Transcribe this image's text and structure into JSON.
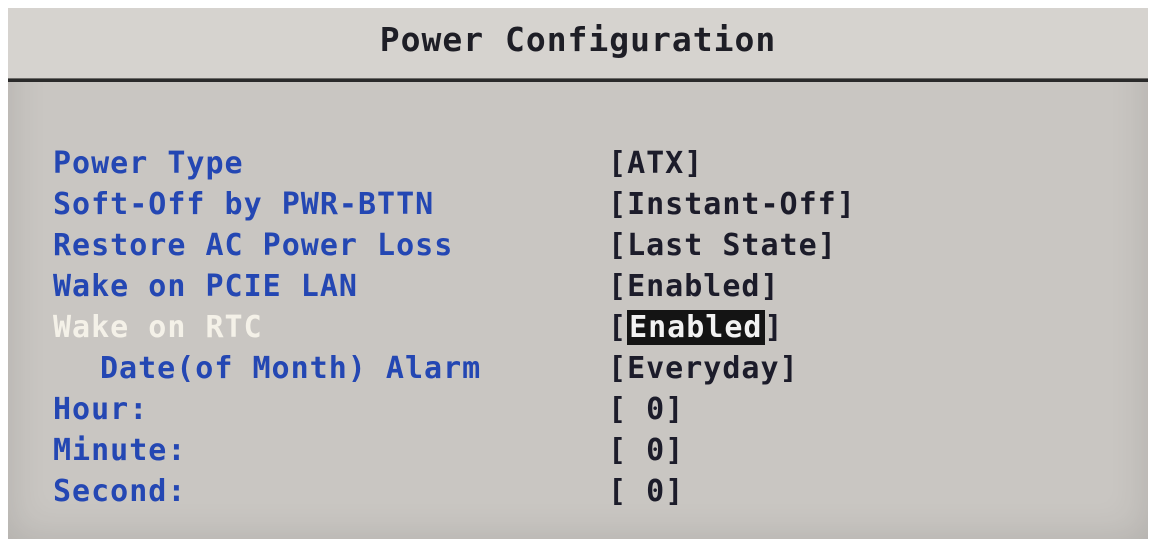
{
  "title": "Power Configuration",
  "items": [
    {
      "label": "Power Type",
      "value": "ATX"
    },
    {
      "label": "Soft-Off by PWR-BTTN",
      "value": "Instant-Off"
    },
    {
      "label": "Restore AC Power Loss",
      "value": "Last State"
    },
    {
      "label": "Wake on PCIE LAN",
      "value": "Enabled"
    },
    {
      "label": "Wake on RTC",
      "value": "Enabled",
      "selected": true
    },
    {
      "label": "Date(of Month) Alarm",
      "value": "Everyday"
    },
    {
      "label": "Hour:",
      "value": " 0"
    },
    {
      "label": "Minute:",
      "value": " 0"
    },
    {
      "label": "Second:",
      "value": " 0"
    }
  ],
  "colors": {
    "label": "#2447b3",
    "selected_label": "#f4f1e8",
    "value": "#1c1c2a",
    "highlight_bg": "#141414",
    "screen_bg": "#c9c6c2"
  }
}
